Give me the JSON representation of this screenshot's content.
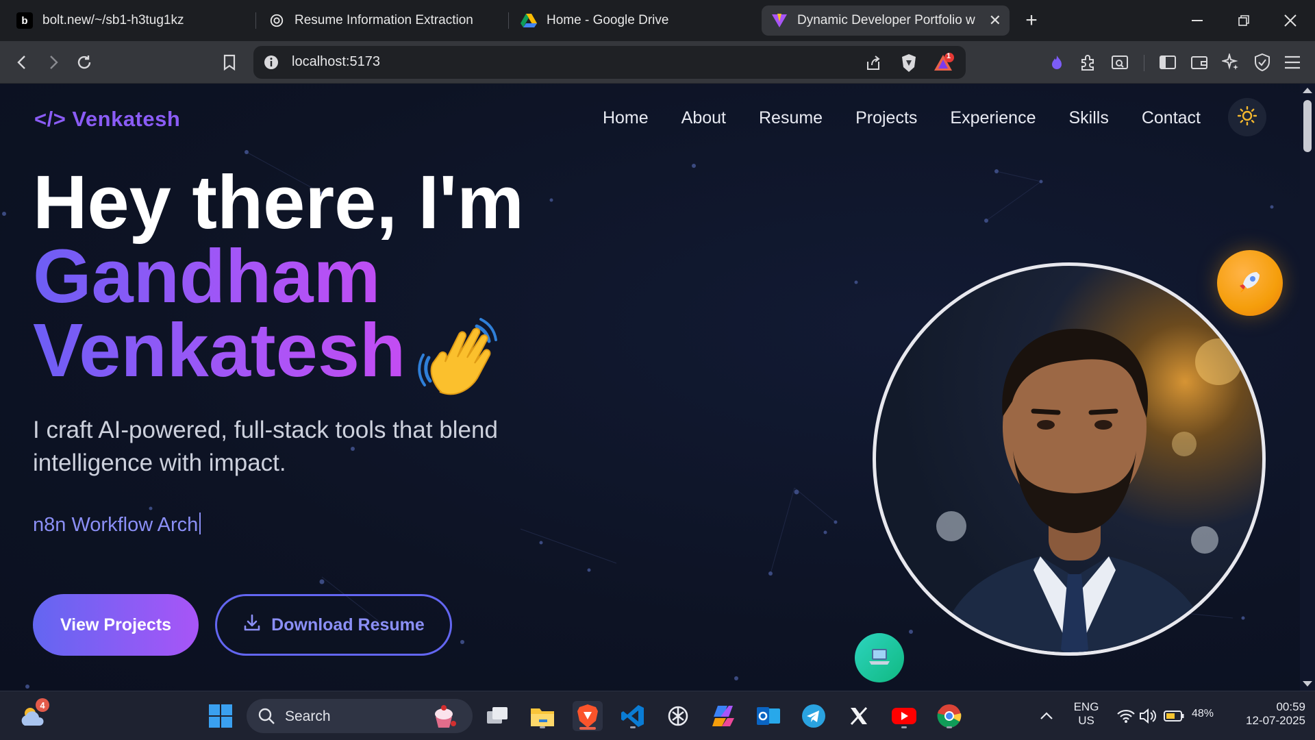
{
  "browser": {
    "tabs": [
      {
        "label": "bolt.new/~/sb1-h3tug1kz",
        "favicon": "bolt-icon",
        "favicon_glyph": "b"
      },
      {
        "label": "Resume Information Extraction",
        "favicon": "chatgpt-icon"
      },
      {
        "label": "Home - Google Drive",
        "favicon": "google-drive-icon"
      },
      {
        "label": "Dynamic Developer Portfolio wit",
        "favicon": "vite-icon",
        "active": true
      }
    ],
    "url": "localhost:5173",
    "notification_count": "1"
  },
  "site": {
    "logo": "</> Venkatesh",
    "nav": [
      "Home",
      "About",
      "Resume",
      "Projects",
      "Experience",
      "Skills",
      "Contact"
    ],
    "hero": {
      "greeting": "Hey there, I'm",
      "first_name": "Gandham",
      "last_name": "Venkatesh",
      "tagline": "I craft AI-powered, full-stack tools that blend intelligence with impact.",
      "typed_text": "n8n Workflow Arch",
      "primary_button": "View Projects",
      "secondary_button": "Download Resume"
    },
    "colors": {
      "accent": "#8b5cf6",
      "gradient_start": "#6366f1",
      "gradient_end": "#d946ef",
      "background": "#0d1324"
    }
  },
  "taskbar": {
    "weather_badge": "4",
    "search_placeholder": "Search",
    "apps": [
      "start",
      "search",
      "task-view",
      "file-explorer",
      "brave",
      "vscode",
      "chatgpt",
      "copilot",
      "outlook",
      "telegram",
      "x",
      "youtube",
      "chrome"
    ],
    "language": "ENG",
    "region": "US",
    "battery": "48%",
    "time": "00:59",
    "date": "12-07-2025"
  }
}
